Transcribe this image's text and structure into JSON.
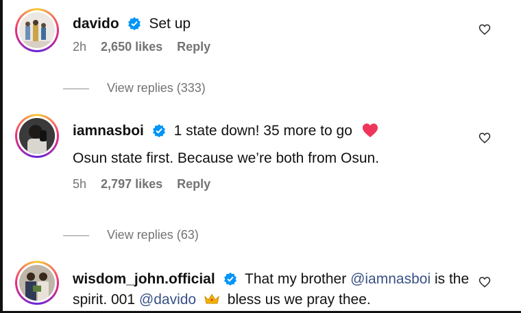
{
  "comments": [
    {
      "username": "davido",
      "text": "Set up",
      "time": "2h",
      "likes": "2,650 likes",
      "reply_label": "Reply",
      "view_replies": "View replies (333)"
    },
    {
      "username": "iamnasboi",
      "text": "1 state down! 35 more to go",
      "extra_text": "Osun state first. Because we’re both from Osun.",
      "time": "5h",
      "likes": "2,797 likes",
      "reply_label": "Reply",
      "view_replies": "View replies (63)"
    },
    {
      "username": "wisdom_john.official",
      "text_part1": "That my brother",
      "mention1": "@iamnasboi",
      "text_part2": "is the",
      "text_part3": "spirit. 001",
      "mention2": "@davido",
      "text_part4": "bless us we pray thee."
    }
  ],
  "colors": {
    "verified": "#0095f6",
    "mention": "#385185",
    "meta": "#737373",
    "heart_emoji": "#f0355a"
  },
  "icons": [
    "verified-badge-icon",
    "heart-outline-icon",
    "red-heart-emoji-icon",
    "crown-emoji-icon"
  ]
}
